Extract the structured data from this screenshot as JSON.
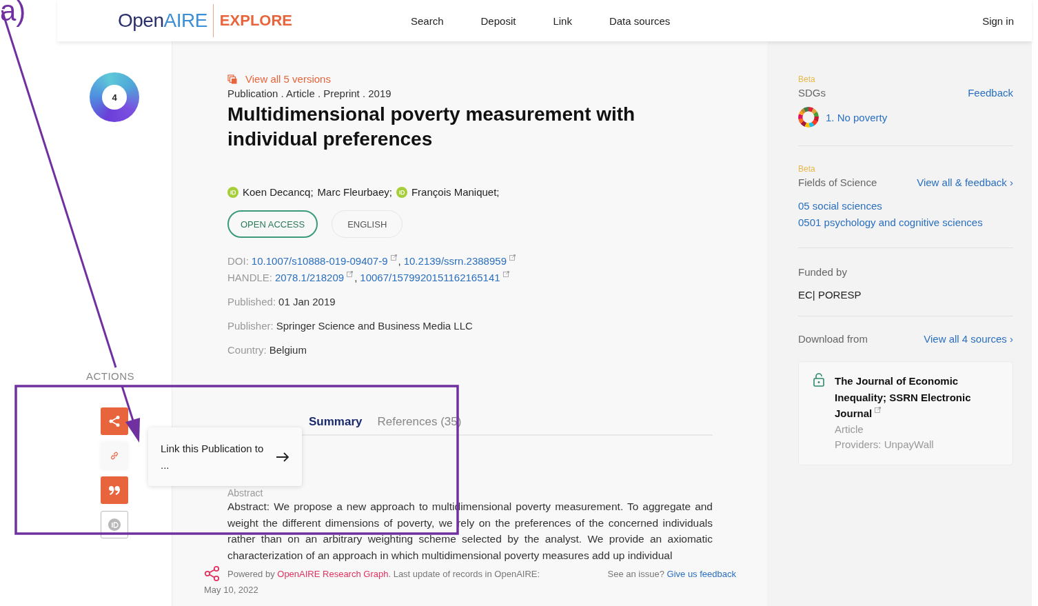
{
  "annotation": {
    "label": "a)",
    "color": "#7030a0"
  },
  "header": {
    "logo_first": "Open",
    "logo_second": "AIRE",
    "section": "EXPLORE",
    "nav": [
      {
        "label": "Search"
      },
      {
        "label": "Deposit"
      },
      {
        "label": "Link"
      },
      {
        "label": "Data sources"
      }
    ],
    "sign_in": "Sign in"
  },
  "altmetric": {
    "score": "4"
  },
  "actions": {
    "title": "ACTIONS",
    "buttons": [
      {
        "kind": "share"
      },
      {
        "kind": "link"
      },
      {
        "kind": "cite"
      },
      {
        "kind": "orcid"
      }
    ]
  },
  "popup": {
    "text": "Link this Publication to ..."
  },
  "record": {
    "versions_link": "View all 5 versions",
    "type_line": "Publication . Article . Preprint . 2019",
    "title": "Multidimensional poverty measurement with individual preferences",
    "authors": [
      {
        "name": "Koen Decancq;",
        "orcid": true
      },
      {
        "name": "Marc Fleurbaey;",
        "orcid": false
      },
      {
        "name": "François Maniquet;",
        "orcid": true
      }
    ],
    "badges": [
      {
        "label": "OPEN ACCESS",
        "kind": "access"
      },
      {
        "label": "ENGLISH",
        "kind": "language"
      }
    ],
    "identifiers": [
      {
        "label": "DOI:",
        "separator": ",",
        "values": [
          "10.1007/s10888-019-09407-9",
          "10.2139/ssrn.2388959"
        ]
      },
      {
        "label": "HANDLE:",
        "separator": ",",
        "values": [
          "2078.1/218209",
          "10067/1579920151162165141"
        ]
      }
    ],
    "fields": [
      {
        "label": "Published:",
        "value": "01 Jan 2019"
      },
      {
        "label": "Publisher:",
        "value": "Springer Science and Business Media LLC"
      },
      {
        "label": "Country:",
        "value": "Belgium"
      }
    ],
    "tabs": [
      {
        "label": "Summary",
        "selected": true
      },
      {
        "label": "References (35)",
        "selected": false
      }
    ],
    "abstract_heading": "Abstract",
    "abstract": "Abstract: We propose a new approach to multidimensional poverty measurement. To aggregate and weight the different dimensions of poverty, we rely on the preferences of the concerned individuals rather than on an arbitrary weighting scheme selected by the analyst. We provide an axiomatic characterization of an approach in which multidimensional poverty measures add up individual"
  },
  "footer": {
    "powered_by": "Powered by",
    "graph_link": "OpenAIRE Research Graph",
    "update_text": ". Last update of records in OpenAIRE:",
    "date": "May 10, 2022",
    "issue": "See an issue?",
    "feedback_link": "Give us feedback"
  },
  "sidebar": {
    "sdgs": {
      "beta": "Beta",
      "title": "SDGs",
      "feedback": "Feedback",
      "items": [
        "1. No poverty"
      ]
    },
    "fields_of_science": {
      "beta": "Beta",
      "title": "Fields of Science",
      "link": "View all & feedback ›",
      "items": [
        "05 social sciences",
        "0501 psychology and cognitive sciences"
      ]
    },
    "funded": {
      "title": "Funded by",
      "value": "EC| PORESP"
    },
    "download": {
      "title": "Download from",
      "link": "View all 4 sources ›",
      "sources": [
        {
          "title": "The Journal of Economic Inequality; SSRN Electronic Journal",
          "type": "Article",
          "providers": "Providers: UnpayWall"
        }
      ]
    }
  }
}
